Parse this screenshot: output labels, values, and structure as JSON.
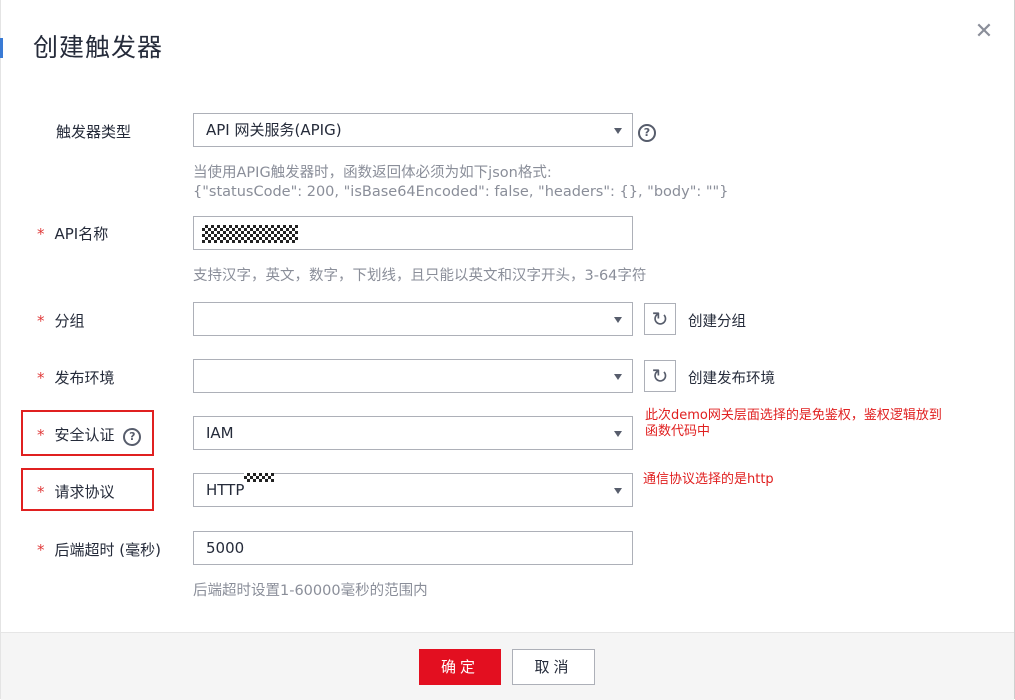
{
  "dialog": {
    "title": "创建触发器",
    "close_icon": "close-icon"
  },
  "form": {
    "trigger_type": {
      "label": "触发器类型",
      "value": "API 网关服务(APIG)",
      "hint_line1": "当使用APIG触发器时，函数返回体必须为如下json格式:",
      "hint_line2": "{\"statusCode\": 200, \"isBase64Encoded\": false, \"headers\": {}, \"body\": \"\"}"
    },
    "api_name": {
      "required_mark": "*",
      "label": "API名称",
      "hint": "支持汉字，英文，数字，下划线，且只能以英文和汉字开头，3-64字符"
    },
    "group": {
      "required_mark": "*",
      "label": "分组",
      "value": "",
      "create_link": "创建分组"
    },
    "environment": {
      "required_mark": "*",
      "label": "发布环境",
      "value": "",
      "create_link": "创建发布环境"
    },
    "auth": {
      "required_mark": "*",
      "label": "安全认证",
      "value": "IAM",
      "annotation_line1": "此次demo网关层面选择的是免鉴权，鉴权逻辑放到",
      "annotation_line2": "函数代码中"
    },
    "protocol": {
      "required_mark": "*",
      "label": "请求协议",
      "value": "HTTP",
      "annotation": "通信协议选择的是http"
    },
    "timeout": {
      "required_mark": "*",
      "label": "后端超时 (毫秒)",
      "value": "5000",
      "hint": "后端超时设置1-60000毫秒的范围内"
    }
  },
  "footer": {
    "ok_label": "确定",
    "cancel_label": "取消"
  },
  "colors": {
    "primary_button": "#e30f20",
    "required_mark": "#e03a3a",
    "annotation": "#e02020",
    "text": "#252b3a",
    "hint": "#8a8e99"
  }
}
